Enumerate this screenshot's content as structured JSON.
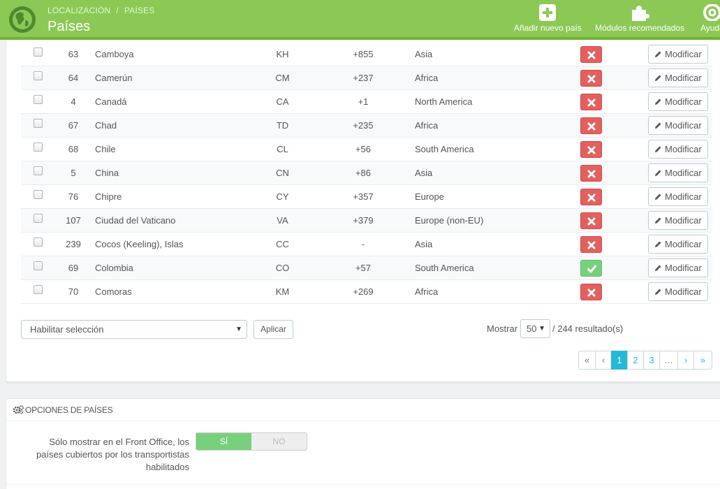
{
  "header": {
    "breadcrumb": [
      "LOCALIZACIÓN",
      "PAÍSES"
    ],
    "title": "Países",
    "actions": [
      {
        "label": "Añadir nuevo país",
        "icon": "plus-square-icon"
      },
      {
        "label": "Módulos recomendados",
        "icon": "puzzle-icon"
      },
      {
        "label": "Ayuda",
        "icon": "lifebuoy-icon"
      }
    ]
  },
  "table": {
    "rows": [
      {
        "id": "63",
        "name": "Camboya",
        "iso": "KH",
        "call_prefix": "+855",
        "zone": "Asia",
        "enabled": false
      },
      {
        "id": "64",
        "name": "Camerún",
        "iso": "CM",
        "call_prefix": "+237",
        "zone": "Africa",
        "enabled": false
      },
      {
        "id": "4",
        "name": "Canadá",
        "iso": "CA",
        "call_prefix": "+1",
        "zone": "North America",
        "enabled": false
      },
      {
        "id": "67",
        "name": "Chad",
        "iso": "TD",
        "call_prefix": "+235",
        "zone": "Africa",
        "enabled": false
      },
      {
        "id": "68",
        "name": "Chile",
        "iso": "CL",
        "call_prefix": "+56",
        "zone": "South America",
        "enabled": false
      },
      {
        "id": "5",
        "name": "China",
        "iso": "CN",
        "call_prefix": "+86",
        "zone": "Asia",
        "enabled": false
      },
      {
        "id": "76",
        "name": "Chipre",
        "iso": "CY",
        "call_prefix": "+357",
        "zone": "Europe",
        "enabled": false
      },
      {
        "id": "107",
        "name": "Ciudad del Vaticano",
        "iso": "VA",
        "call_prefix": "+379",
        "zone": "Europe (non-EU)",
        "enabled": false
      },
      {
        "id": "239",
        "name": "Cocos (Keeling), Islas",
        "iso": "CC",
        "call_prefix": "-",
        "zone": "Asia",
        "enabled": false
      },
      {
        "id": "69",
        "name": "Colombia",
        "iso": "CO",
        "call_prefix": "+57",
        "zone": "South America",
        "enabled": true
      },
      {
        "id": "70",
        "name": "Comoras",
        "iso": "KM",
        "call_prefix": "+269",
        "zone": "Africa",
        "enabled": false
      }
    ],
    "edit_label": "Modificar"
  },
  "bulk": {
    "selected": "Habilitar selección",
    "apply_label": "Aplicar"
  },
  "pagination": {
    "show_label": "Mostrar",
    "per_page": "50",
    "results": "/ 244 resultado(s)",
    "pages": [
      "«",
      "‹",
      "1",
      "2",
      "3",
      "…",
      "›",
      "»"
    ],
    "active": "1"
  },
  "options": {
    "title": "OPCIONES DE PAÍSES",
    "restrict_label": "Sólo mostrar en el Front Office, los países cubiertos por los transportistas habilitados",
    "yes": "SÍ",
    "no": "NO"
  },
  "colors": {
    "header_green": "#8bc954",
    "disabled_red": "#e4605e",
    "enabled_green": "#78d07d",
    "accent_blue": "#25b9d7"
  }
}
